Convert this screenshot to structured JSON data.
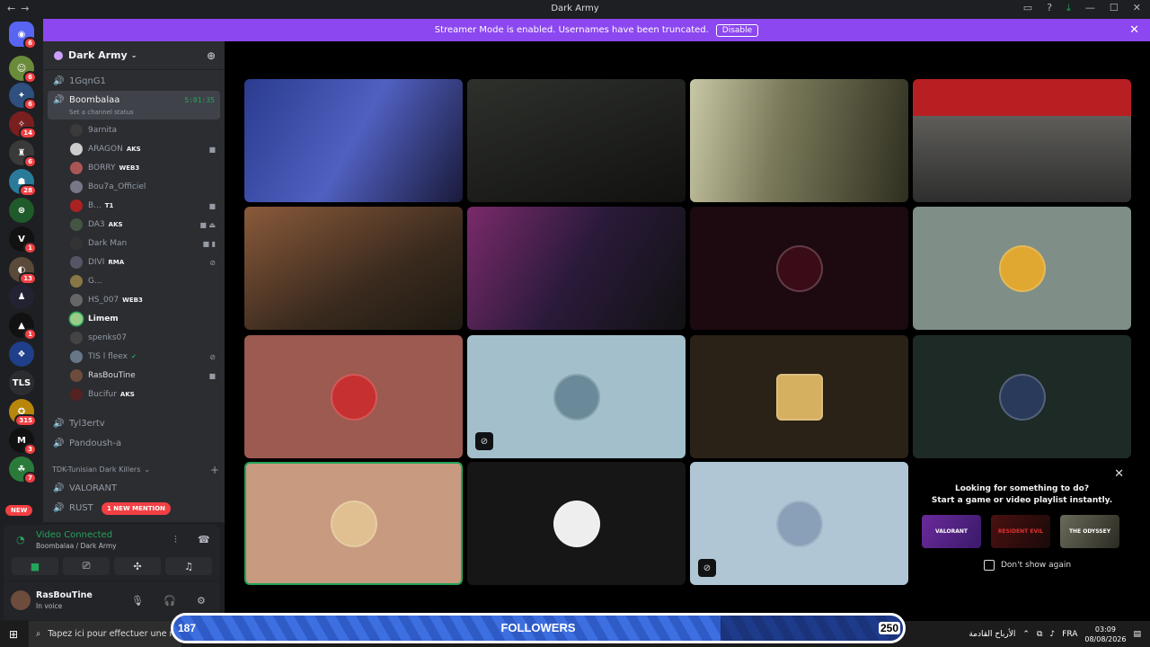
{
  "window": {
    "title": "Dark Army"
  },
  "banner": {
    "text": "Streamer Mode is enabled. Usernames have been truncated.",
    "button": "Disable"
  },
  "server": {
    "name": "Dark Army"
  },
  "guild_badges": [
    "6",
    "6",
    "6",
    "14",
    "6",
    "28",
    "1",
    "13",
    "1",
    "TLS",
    "315",
    "3",
    "7",
    "NEW"
  ],
  "channels": {
    "top": "1GqnG1",
    "active": {
      "name": "Boombalaa",
      "time": "5:01:35",
      "status": "Set a channel status"
    },
    "members": [
      {
        "name": "9arnita",
        "tag": ""
      },
      {
        "name": "ARAGON",
        "tag": "AKS"
      },
      {
        "name": "BORRY",
        "tag": "WEB3"
      },
      {
        "name": "Bou7a_Officiel",
        "tag": ""
      },
      {
        "name": "B...",
        "tag": "T1"
      },
      {
        "name": "DA3",
        "tag": "AKS"
      },
      {
        "name": "Dark Man",
        "tag": ""
      },
      {
        "name": "DIVI",
        "tag": "RMA"
      },
      {
        "name": "G...",
        "tag": ""
      },
      {
        "name": "HS_007",
        "tag": "WEB3"
      },
      {
        "name": "Limem",
        "tag": ""
      },
      {
        "name": "spenks07",
        "tag": ""
      },
      {
        "name": "TIS l fleex",
        "tag": ""
      },
      {
        "name": "RasBouTine",
        "tag": ""
      },
      {
        "name": "Bucifur",
        "tag": "AKS"
      }
    ],
    "other": [
      "Tyl3ertv",
      "Pandoush-a"
    ],
    "category": "TDK-Tunisian Dark Killers",
    "cat_channels": [
      "VALORANT",
      "RUST"
    ],
    "mention": "1 NEW MENTION"
  },
  "voice": {
    "title": "Video Connected",
    "sub": "Boombalaa / Dark Army"
  },
  "user": {
    "name": "RasBouTine",
    "status": "In voice"
  },
  "promo": {
    "line1": "Looking for something to do?",
    "line2": "Start a game or video playlist instantly.",
    "cards": [
      "VALORANT",
      "RESIDENT EVIL",
      "THE ODYSSEY"
    ],
    "checkbox": "Don't show again"
  },
  "taskbar": {
    "search": "Tapez ici pour effectuer une re",
    "news": "الأرباح القادمة",
    "lang": "FRA",
    "time": "03:09",
    "date": "08/08/2026"
  },
  "followers": {
    "label": "FOLLOWERS",
    "current": "187",
    "goal": "250",
    "progress": 0.75
  },
  "colors": {
    "accent": "#8c47f0",
    "online": "#23a55a",
    "danger": "#f23f43"
  }
}
